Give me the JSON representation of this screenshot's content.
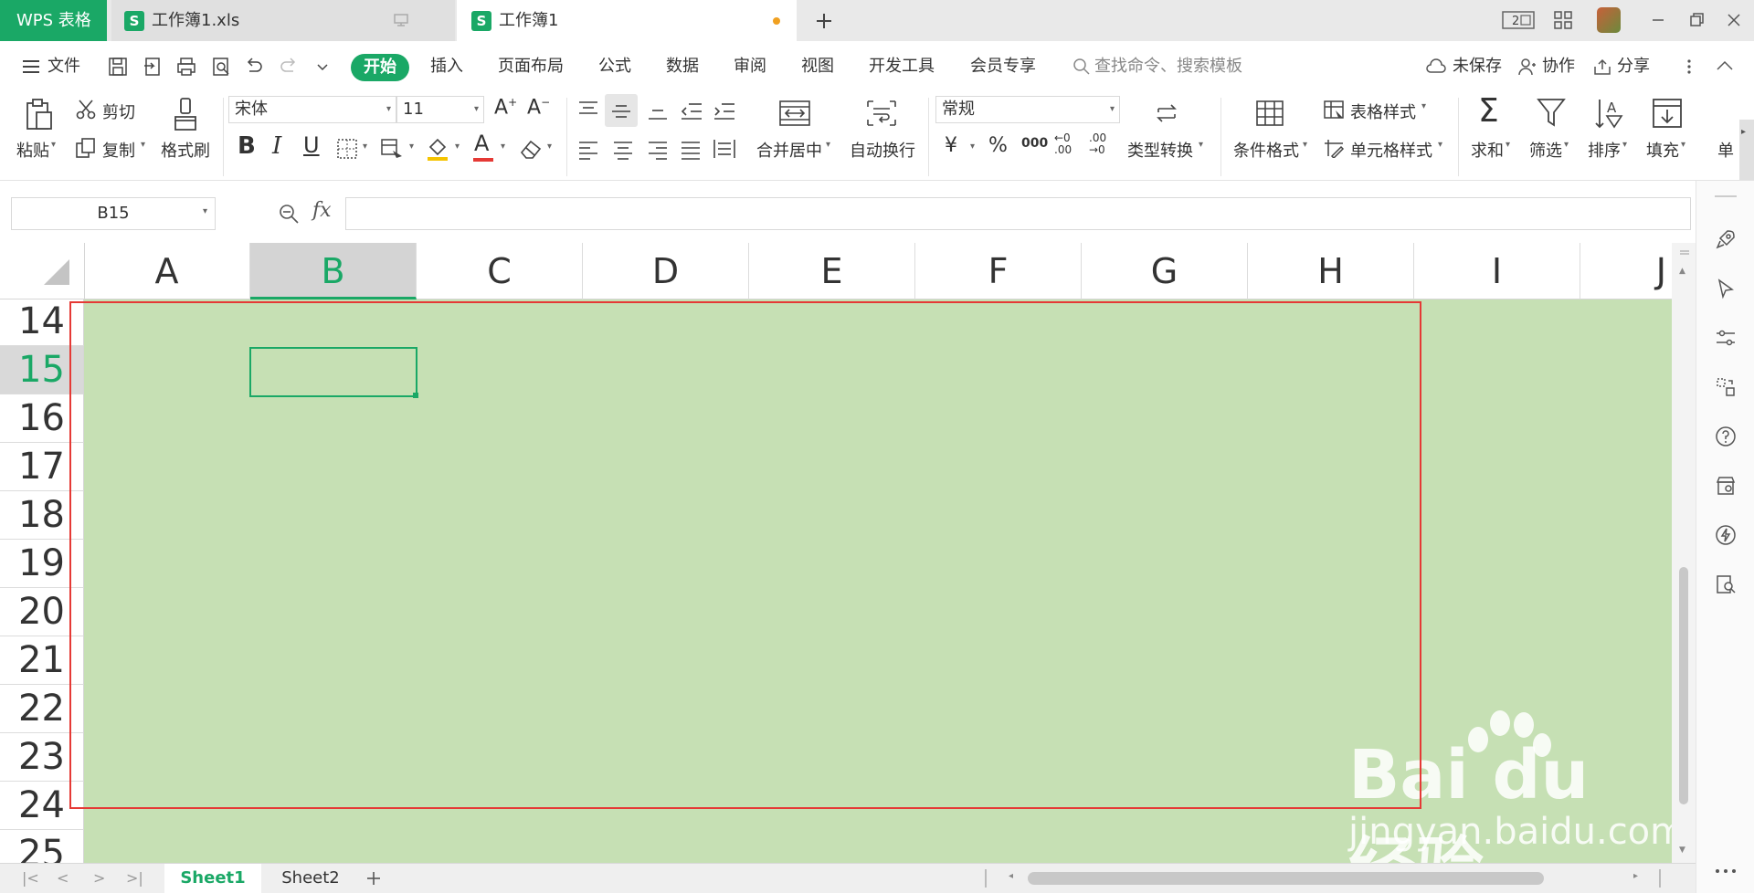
{
  "app": {
    "name": "WPS 表格",
    "tabs": [
      {
        "label": "工作簿1.xls",
        "icon": "S"
      },
      {
        "label": "工作簿1",
        "icon": "S"
      }
    ]
  },
  "menu": {
    "file": "文件",
    "items": [
      "开始",
      "插入",
      "页面布局",
      "公式",
      "数据",
      "审阅",
      "视图",
      "开发工具",
      "会员专享"
    ],
    "search_placeholder": "查找命令、搜索模板",
    "unsaved": "未保存",
    "collab": "协作",
    "share": "分享"
  },
  "ribbon": {
    "paste": "粘贴",
    "cut": "剪切",
    "copy": "复制",
    "format_painter": "格式刷",
    "font_name": "宋体",
    "font_size": "11",
    "merge_center": "合并居中",
    "wrap_text": "自动换行",
    "number_format": "常规",
    "type_convert": "类型转换",
    "cond_format": "条件格式",
    "table_style": "表格样式",
    "cell_style": "单元格样式",
    "sum": "求和",
    "filter": "筛选",
    "sort": "排序",
    "fill": "填充",
    "single": "单"
  },
  "formula_bar": {
    "name_box": "B15",
    "fx": "fx",
    "value": ""
  },
  "grid": {
    "columns": [
      "A",
      "B",
      "C",
      "D",
      "E",
      "F",
      "G",
      "H",
      "I",
      "J"
    ],
    "selected_column": "B",
    "rows": [
      "14",
      "15",
      "16",
      "17",
      "18",
      "19",
      "20",
      "21",
      "22",
      "23",
      "24",
      "25"
    ],
    "selected_row": "15",
    "fill_color": "#c6e0b4",
    "highlight_border_color": "#e53935"
  },
  "sheets": {
    "tabs": [
      "Sheet1",
      "Sheet2"
    ],
    "active": "Sheet1"
  },
  "watermark": {
    "brand": "Bai du 经验",
    "url": "jingyan.baidu.com"
  },
  "colors": {
    "accent": "#1aa866"
  }
}
